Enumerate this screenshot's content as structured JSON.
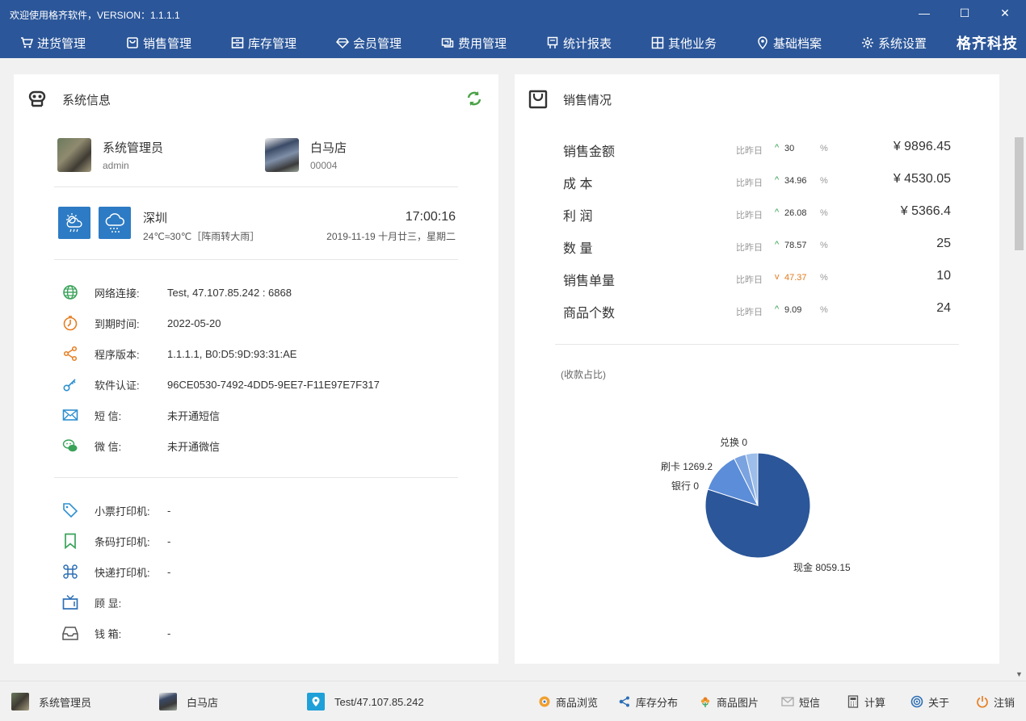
{
  "window": {
    "title": "欢迎使用格齐软件，VERSION：1.1.1.1",
    "minimize": "—",
    "maximize": "☐",
    "close": "✕"
  },
  "menu": {
    "items": [
      {
        "label": "进货管理",
        "icon": "cart-icon"
      },
      {
        "label": "销售管理",
        "icon": "bag-icon"
      },
      {
        "label": "库存管理",
        "icon": "warehouse-icon"
      },
      {
        "label": "会员管理",
        "icon": "diamond-icon"
      },
      {
        "label": "费用管理",
        "icon": "money-icon"
      },
      {
        "label": "统计报表",
        "icon": "report-icon"
      },
      {
        "label": "其他业务",
        "icon": "grid-icon"
      },
      {
        "label": "基础档案",
        "icon": "location-icon"
      },
      {
        "label": "系统设置",
        "icon": "gear-icon"
      }
    ],
    "brand": "格齐科技"
  },
  "system_info": {
    "title": "系统信息",
    "user": {
      "name": "系统管理员",
      "id": "admin"
    },
    "store": {
      "name": "白马店",
      "code": "00004"
    },
    "weather": {
      "city": "深圳",
      "temp": "24℃≈30℃［阵雨转大雨］",
      "time": "17:00:16",
      "date": "2019-11-19 十月廿三，星期二"
    },
    "details": [
      {
        "label": "网络连接:",
        "value": "Test,  47.107.85.242 : 6868",
        "icon": "globe-icon",
        "color": "#3aa35a"
      },
      {
        "label": "到期时间:",
        "value": "2022-05-20",
        "icon": "timer-icon",
        "color": "#e67e22"
      },
      {
        "label": "程序版本:",
        "value": "1.1.1.1,   B0:D5:9D:93:31:AE",
        "icon": "share-icon",
        "color": "#e67e22"
      },
      {
        "label": "软件认证:",
        "value": "96CE0530-7492-4DD5-9EE7-F11E97E7F317",
        "icon": "key-icon",
        "color": "#2d8fd0"
      },
      {
        "label": "短  信:",
        "value": "未开通短信",
        "icon": "mail-icon",
        "color": "#2d8fd0"
      },
      {
        "label": "微  信:",
        "value": "未开通微信",
        "icon": "wechat-icon",
        "color": "#3aa35a"
      }
    ],
    "devices": [
      {
        "label": "小票打印机:",
        "value": "-",
        "icon": "tag-icon",
        "color": "#2d8fd0"
      },
      {
        "label": "条码打印机:",
        "value": "-",
        "icon": "bookmark-icon",
        "color": "#3aa35a"
      },
      {
        "label": "快递打印机:",
        "value": "-",
        "icon": "command-icon",
        "color": "#2d6fb6"
      },
      {
        "label": "顾  显:",
        "value": "",
        "icon": "tv-icon",
        "color": "#2d6fb6"
      },
      {
        "label": "钱  箱:",
        "value": "-",
        "icon": "inbox-icon",
        "color": "#555555"
      }
    ]
  },
  "sales": {
    "title": "销售情况",
    "compare_label": "比昨日",
    "pct_sign": "%",
    "rows": [
      {
        "label": "销售金额",
        "dir": "up",
        "arrow": "^",
        "pct": "30",
        "value": "¥ 9896.45"
      },
      {
        "label": "成  本",
        "dir": "up",
        "arrow": "^",
        "pct": "34.96",
        "value": "¥ 4530.05"
      },
      {
        "label": "利  润",
        "dir": "up",
        "arrow": "^",
        "pct": "26.08",
        "value": "¥ 5366.4"
      },
      {
        "label": "数  量",
        "dir": "up",
        "arrow": "^",
        "pct": "78.57",
        "value": "25"
      },
      {
        "label": "销售单量",
        "dir": "down",
        "arrow": "v",
        "pct": "47.37",
        "value": "10"
      },
      {
        "label": "商品个数",
        "dir": "up",
        "arrow": "^",
        "pct": "9.09",
        "value": "24"
      }
    ]
  },
  "chart_data": {
    "type": "pie",
    "title": "(收款占比)",
    "slices": [
      {
        "name": "现金",
        "value": 8059.15,
        "label": "现金 8059.15",
        "color": "#2b5699"
      },
      {
        "name": "刷卡",
        "value": 1269.2,
        "label": "刷卡 1269.2",
        "color": "#5b8dd9"
      },
      {
        "name": "银行",
        "value": 0,
        "label": "银行 0",
        "color": "#7aa3e0"
      },
      {
        "name": "兑换",
        "value": 0,
        "label": "兑换 0",
        "color": "#9dbdea"
      }
    ]
  },
  "statusbar": {
    "user": "系统管理员",
    "store": "白马店",
    "server": "Test/47.107.85.242",
    "actions": [
      {
        "label": "商品浏览",
        "icon": "browse-icon",
        "color": "#e67e22"
      },
      {
        "label": "库存分布",
        "icon": "distribution-icon",
        "color": "#2d6fb6"
      },
      {
        "label": "商品图片",
        "icon": "flower-icon",
        "color": "#e67e22"
      },
      {
        "label": "短信",
        "icon": "mail-icon",
        "color": "#aaaaaa"
      },
      {
        "label": "计算",
        "icon": "calculator-icon",
        "color": "#555555"
      },
      {
        "label": "关于",
        "icon": "about-icon",
        "color": "#2d6fb6"
      },
      {
        "label": "注销",
        "icon": "power-icon",
        "color": "#e67e22"
      }
    ]
  }
}
